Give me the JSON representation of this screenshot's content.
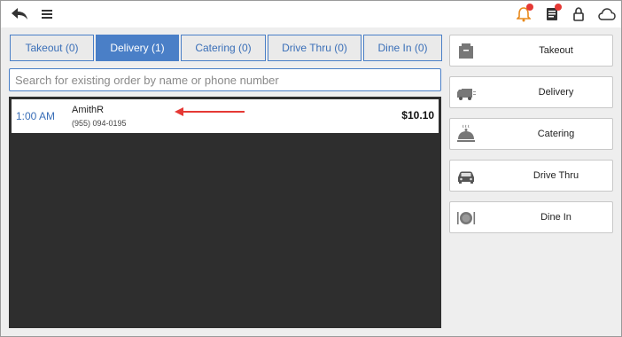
{
  "tabs": [
    {
      "label": "Takeout (0)",
      "active": false
    },
    {
      "label": "Delivery (1)",
      "active": true
    },
    {
      "label": "Catering (0)",
      "active": false
    },
    {
      "label": "Drive Thru (0)",
      "active": false
    },
    {
      "label": "Dine In (0)",
      "active": false
    }
  ],
  "search": {
    "placeholder": "Search for existing order by name or phone number",
    "value": ""
  },
  "orders": [
    {
      "time": "1:00 AM",
      "name": "AmithR",
      "phone": "(955) 094-0195",
      "amount": "$10.10"
    }
  ],
  "side_buttons": [
    {
      "label": "Takeout",
      "icon": "takeout-box-icon"
    },
    {
      "label": "Delivery",
      "icon": "delivery-truck-icon"
    },
    {
      "label": "Catering",
      "icon": "catering-cloche-icon"
    },
    {
      "label": "Drive Thru",
      "icon": "car-icon"
    },
    {
      "label": "Dine In",
      "icon": "plate-cutlery-icon"
    }
  ],
  "topbar": {
    "icons": [
      "back-icon",
      "menu-icon",
      "bell-icon",
      "orders-icon",
      "lock-icon",
      "cloud-icon"
    ]
  },
  "colors": {
    "accent": "#4a7fc7",
    "badge": "#e53935",
    "annotation_arrow": "#e53935",
    "order_panel_bg": "#2e2e2e",
    "background": "#eeeeee"
  }
}
